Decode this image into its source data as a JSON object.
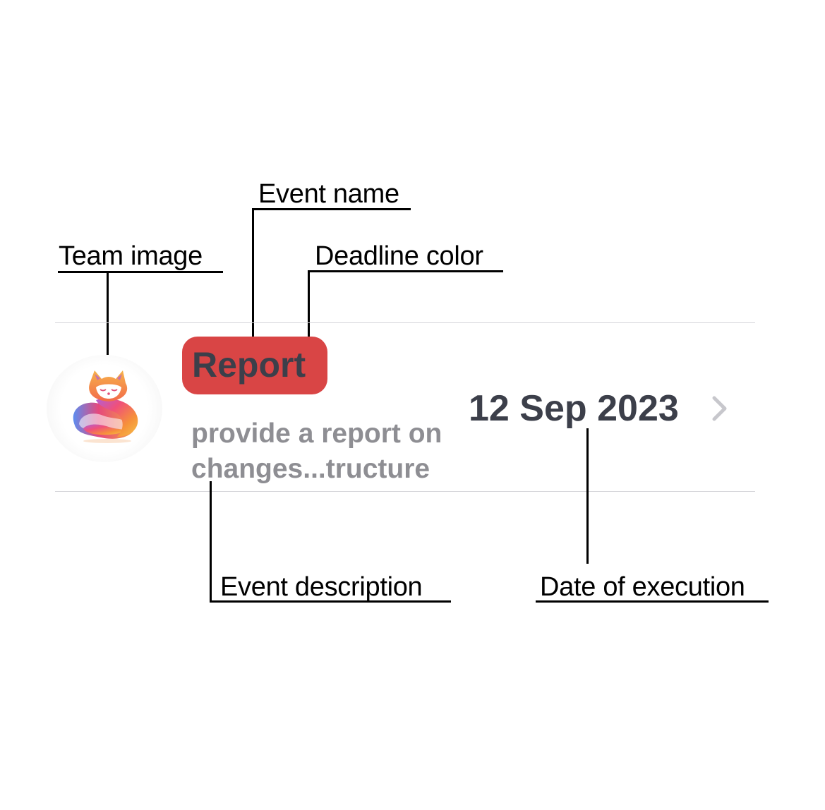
{
  "annotations": {
    "event_name": "Event name",
    "team_image": "Team image",
    "deadline_color": "Deadline color",
    "event_description": "Event description",
    "date_of_execution": "Date of execution"
  },
  "event": {
    "name": "Report",
    "description_line1": "provide a report on",
    "description_line2": "changes...tructure",
    "date": "12 Sep 2023",
    "deadline_color": "#d94545",
    "team_image_icon": "fox-logo-icon",
    "chevron_icon": "chevron-right-icon"
  },
  "colors": {
    "primary_text": "#3c3f4a",
    "secondary_text": "#8e8e93",
    "divider": "#d4d4d8"
  }
}
